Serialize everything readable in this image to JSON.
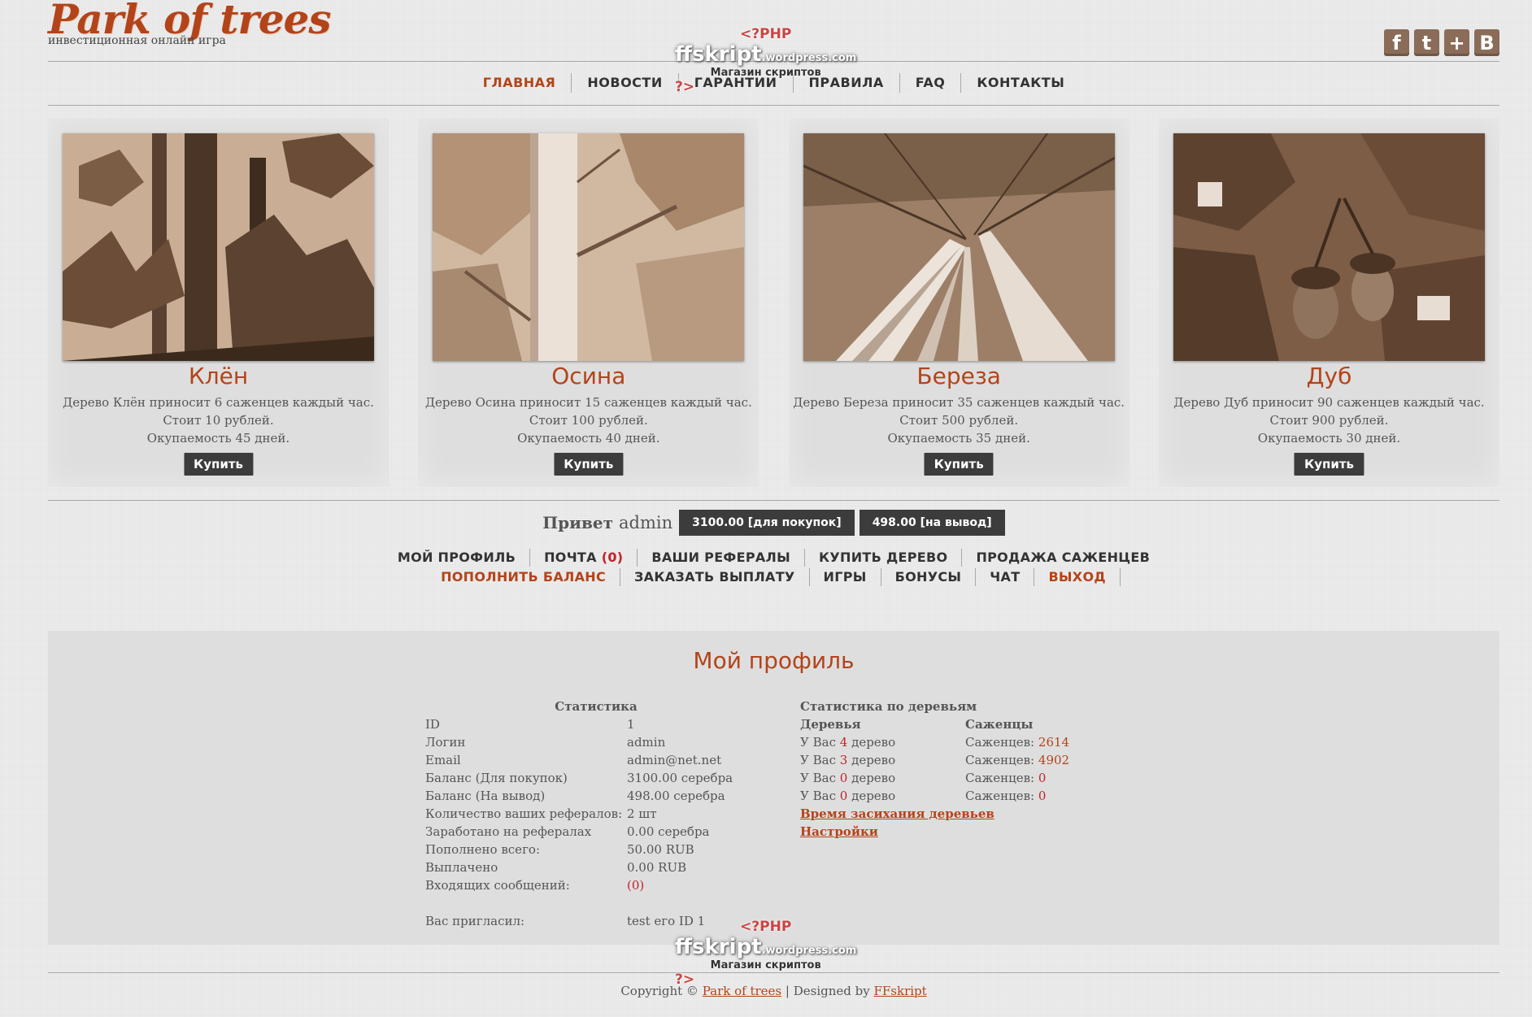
{
  "header": {
    "logo": "Park of trees",
    "tagline": "инвестиционная онлайн игра",
    "social": [
      {
        "icon": "facebook-icon",
        "glyph": "f"
      },
      {
        "icon": "twitter-icon",
        "glyph": "t"
      },
      {
        "icon": "plus-icon",
        "glyph": "+"
      },
      {
        "icon": "vkontakte-icon",
        "glyph": "B"
      }
    ]
  },
  "nav": [
    "Главная",
    "Новости",
    "Гарантии",
    "Правила",
    "FAQ",
    "Контакты"
  ],
  "cards": [
    {
      "title": "Клён",
      "line1": "Дерево Клён приносит 6 саженцев каждый час.",
      "line2": "Стоит 10 рублей.",
      "line3": "Окупаемость 45 дней.",
      "buy": "Купить"
    },
    {
      "title": "Осина",
      "line1": "Дерево Осина приносит 15 саженцев каждый час.",
      "line2": "Стоит 100 рублей.",
      "line3": "Окупаемость 40 дней.",
      "buy": "Купить"
    },
    {
      "title": "Береза",
      "line1": "Дерево Береза приносит 35 саженцев каждый час.",
      "line2": "Стоит 500 рублей.",
      "line3": "Окупаемость 35 дней.",
      "buy": "Купить"
    },
    {
      "title": "Дуб",
      "line1": "Дерево Дуб приносит 90 саженцев каждый час.",
      "line2": "Стоит 900 рублей.",
      "line3": "Окупаемость 30 дней.",
      "buy": "Купить"
    }
  ],
  "user": {
    "greeting": "Привет",
    "name": "admin",
    "balance_buy": "3100.00 [для покупок]",
    "balance_withdraw": "498.00 [на вывод]"
  },
  "menu": {
    "row1": [
      "Мой профиль",
      "Почта",
      "Ваши рефералы",
      "Купить дерево",
      "Продажа саженцев"
    ],
    "mail_count": "(0)",
    "row2": [
      "Пополнить баланс",
      "Заказать выплату",
      "Игры",
      "Бонусы",
      "Чат",
      "Выход"
    ]
  },
  "profile": {
    "title": "Мой профиль",
    "stats_header": "Статистика",
    "stats": [
      {
        "label": "ID",
        "value": "1"
      },
      {
        "label": "Логин",
        "value": "admin"
      },
      {
        "label": "Email",
        "value": "admin@net.net"
      },
      {
        "label": "Баланс (Для покупок)",
        "value": "3100.00 серебра"
      },
      {
        "label": "Баланс (На вывод)",
        "value": "498.00 серебра"
      },
      {
        "label": "Количество ваших рефералов:",
        "value": "2 шт"
      },
      {
        "label": "Заработано на рефералах",
        "value": "0.00 серебра"
      },
      {
        "label": "Пополнено всего:",
        "value": "50.00 RUB"
      },
      {
        "label": "Выплачено",
        "value": "0.00 RUB"
      },
      {
        "label": "Входящих сообщений:",
        "value": "(0)"
      }
    ],
    "invited_label": "Вас пригласил:",
    "invited_value": "test его ID 1",
    "trees_header": "Статистика по деревьям",
    "trees_col": "Деревья",
    "seedlings_col": "Саженцы",
    "trees_prefix": "У Вас",
    "trees_suffix": "дерево",
    "seedlings_prefix": "Саженцев:",
    "trees_counts": [
      "4",
      "3",
      "0",
      "0"
    ],
    "seedlings_counts": [
      "2614",
      "4902",
      "0",
      "0"
    ],
    "link1": "Время засихания деревьев",
    "link2": "Настройки"
  },
  "footer": {
    "copyright": "Copyright ©",
    "site": "Park of trees",
    "designed": "| Designed by",
    "designer": "FFskript"
  },
  "watermark": {
    "php": "<?PHP",
    "brand": "ffskript",
    "domain": ".wordpress.com",
    "sub": "Магазин скриптов",
    "end": "?>"
  },
  "colors": {
    "accent": "#b3441a",
    "dark_button": "#3c3c3c",
    "red": "#c0222b",
    "panel": "#dedede"
  }
}
